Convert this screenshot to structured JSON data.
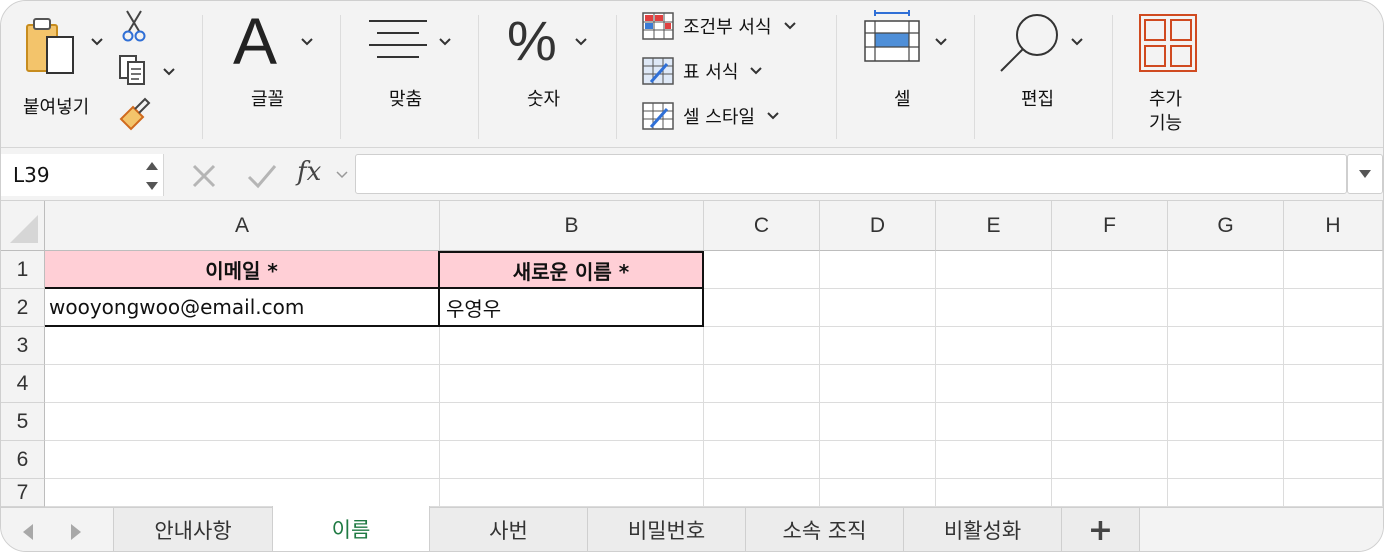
{
  "ribbon": {
    "paste_label": "붙여넣기",
    "font_label": "글꼴",
    "font_glyph": "A",
    "align_label": "맞춤",
    "number_label": "숫자",
    "number_glyph": "%",
    "conditional_label": "조건부 서식",
    "table_label": "표 서식",
    "cellstyle_label": "셀 스타일",
    "cells_label": "셀",
    "edit_label": "편집",
    "addins_label_1": "추가",
    "addins_label_2": "기능",
    "accent_color": "#d04a20"
  },
  "formula_bar": {
    "name_box": "L39",
    "fx": "fx",
    "formula": ""
  },
  "grid": {
    "columns": [
      "A",
      "B",
      "C",
      "D",
      "E",
      "F",
      "G",
      "H"
    ],
    "rows": [
      "1",
      "2",
      "3",
      "4",
      "5",
      "6",
      "7"
    ],
    "header_fill": "#ffcfd6",
    "cells": {
      "a1": "이메일 *",
      "b1": "새로운 이름 *",
      "a2": "wooyongwoo@email.com",
      "b2": "우영우"
    }
  },
  "sheets": {
    "tabs": [
      "안내사항",
      "이름",
      "사번",
      "비밀번호",
      "소속 조직",
      "비활성화"
    ],
    "active": "이름",
    "add_label": "+"
  }
}
